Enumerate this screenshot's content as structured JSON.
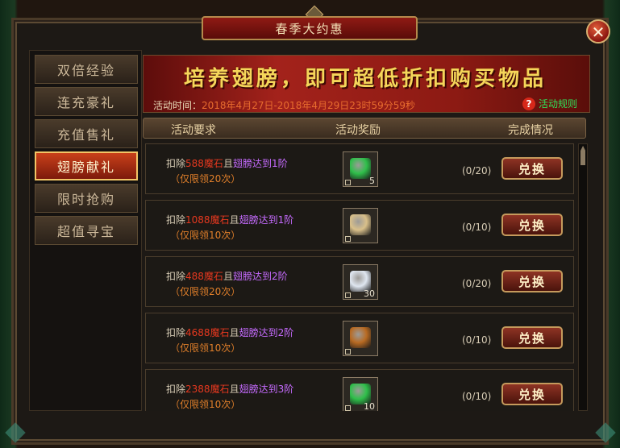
{
  "title": "春季大约惠",
  "close_label": "✕",
  "nav": [
    "双倍经验",
    "连充豪礼",
    "充值售礼",
    "翅膀献礼",
    "限时抢购",
    "超值寻宝"
  ],
  "active_nav": 3,
  "banner": {
    "headline": "培养翅膀，即可超低折扣购买物品",
    "time_label": "活动时间：",
    "time_value": "2018年4月27日-2018年4月29日23时59分59秒",
    "rule_icon": "?",
    "rule_label": "活动规则"
  },
  "columns": {
    "req": "活动要求",
    "reward": "活动奖励",
    "status": "完成情况"
  },
  "rows": [
    {
      "pre": "扣除",
      "num": "588",
      "ms": "魔石",
      "and": "且",
      "wing": "翅膀达到1阶",
      "limit": "（仅限领20次）",
      "item_icon": "green-gem-icon",
      "count": "5",
      "progress": "(0/20)",
      "btn": "兑换",
      "color": "#2fbf4a"
    },
    {
      "pre": "扣除",
      "num": "1088",
      "ms": "魔石",
      "and": "且",
      "wing": "翅膀达到1阶",
      "limit": "（仅限领10次）",
      "item_icon": "scroll-icon",
      "count": "",
      "progress": "(0/10)",
      "btn": "兑换",
      "color": "#d9c08a"
    },
    {
      "pre": "扣除",
      "num": "488",
      "ms": "魔石",
      "and": "且",
      "wing": "翅膀达到2阶",
      "limit": "（仅限领20次）",
      "item_icon": "feather-icon",
      "count": "30",
      "progress": "(0/20)",
      "btn": "兑换",
      "color": "#dfe6f0"
    },
    {
      "pre": "扣除",
      "num": "4688",
      "ms": "魔石",
      "and": "且",
      "wing": "翅膀达到2阶",
      "limit": "（仅限领10次）",
      "item_icon": "bronze-coin-icon",
      "count": "",
      "progress": "(0/10)",
      "btn": "兑换",
      "color": "#b86a22"
    },
    {
      "pre": "扣除",
      "num": "2388",
      "ms": "魔石",
      "and": "且",
      "wing": "翅膀达到3阶",
      "limit": "（仅限领10次）",
      "item_icon": "green-gem-icon",
      "count": "10",
      "progress": "(0/10)",
      "btn": "兑换",
      "color": "#2fbf4a"
    }
  ]
}
